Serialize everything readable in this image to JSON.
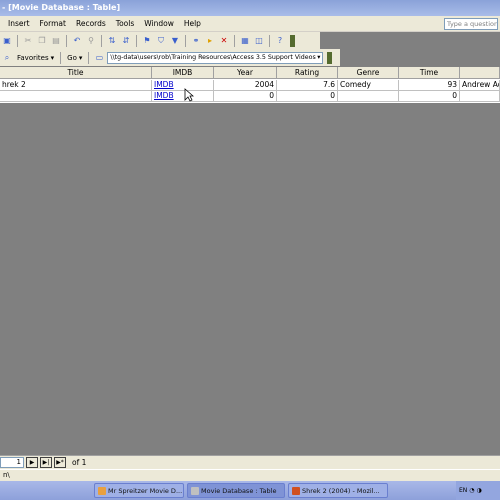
{
  "window": {
    "title": "- [Movie Database : Table]"
  },
  "menu": {
    "items": [
      "Insert",
      "Format",
      "Records",
      "Tools",
      "Window",
      "Help"
    ],
    "help_placeholder": "Type a question"
  },
  "toolbar2": {
    "favorites": "Favorites",
    "go": "Go",
    "address": "\\\\tg-data\\users\\rob\\Training Resources\\Access 3.5 Support Videos"
  },
  "table": {
    "columns": [
      "Title",
      "IMDB",
      "Year",
      "Rating",
      "Genre",
      "Time",
      ""
    ],
    "rows": [
      {
        "title": "hrek 2",
        "imdb": "IMDB",
        "year": "2004",
        "rating": "7.6",
        "genre": "Comedy",
        "time": "93",
        "extra": "Andrew Ad"
      },
      {
        "title": "",
        "imdb": "IMDB",
        "year": "0",
        "rating": "0",
        "genre": "",
        "time": "0",
        "extra": ""
      }
    ]
  },
  "record_nav": {
    "current": "1",
    "of_label": "of 1"
  },
  "status": {
    "text": "n\\"
  },
  "taskbar": {
    "tasks": [
      {
        "label": "Mr Spreitzer Movie D...",
        "icon_color": "#e8a040"
      },
      {
        "label": "Movie Database : Table",
        "icon_color": "#c0c0c0"
      },
      {
        "label": "Shrek 2 (2004) - Mozil...",
        "icon_color": "#d05020"
      }
    ],
    "tray": "EN"
  },
  "colors": {
    "link": "#0000cc",
    "desktop_gray": "#808080",
    "chrome": "#ece9d8"
  }
}
